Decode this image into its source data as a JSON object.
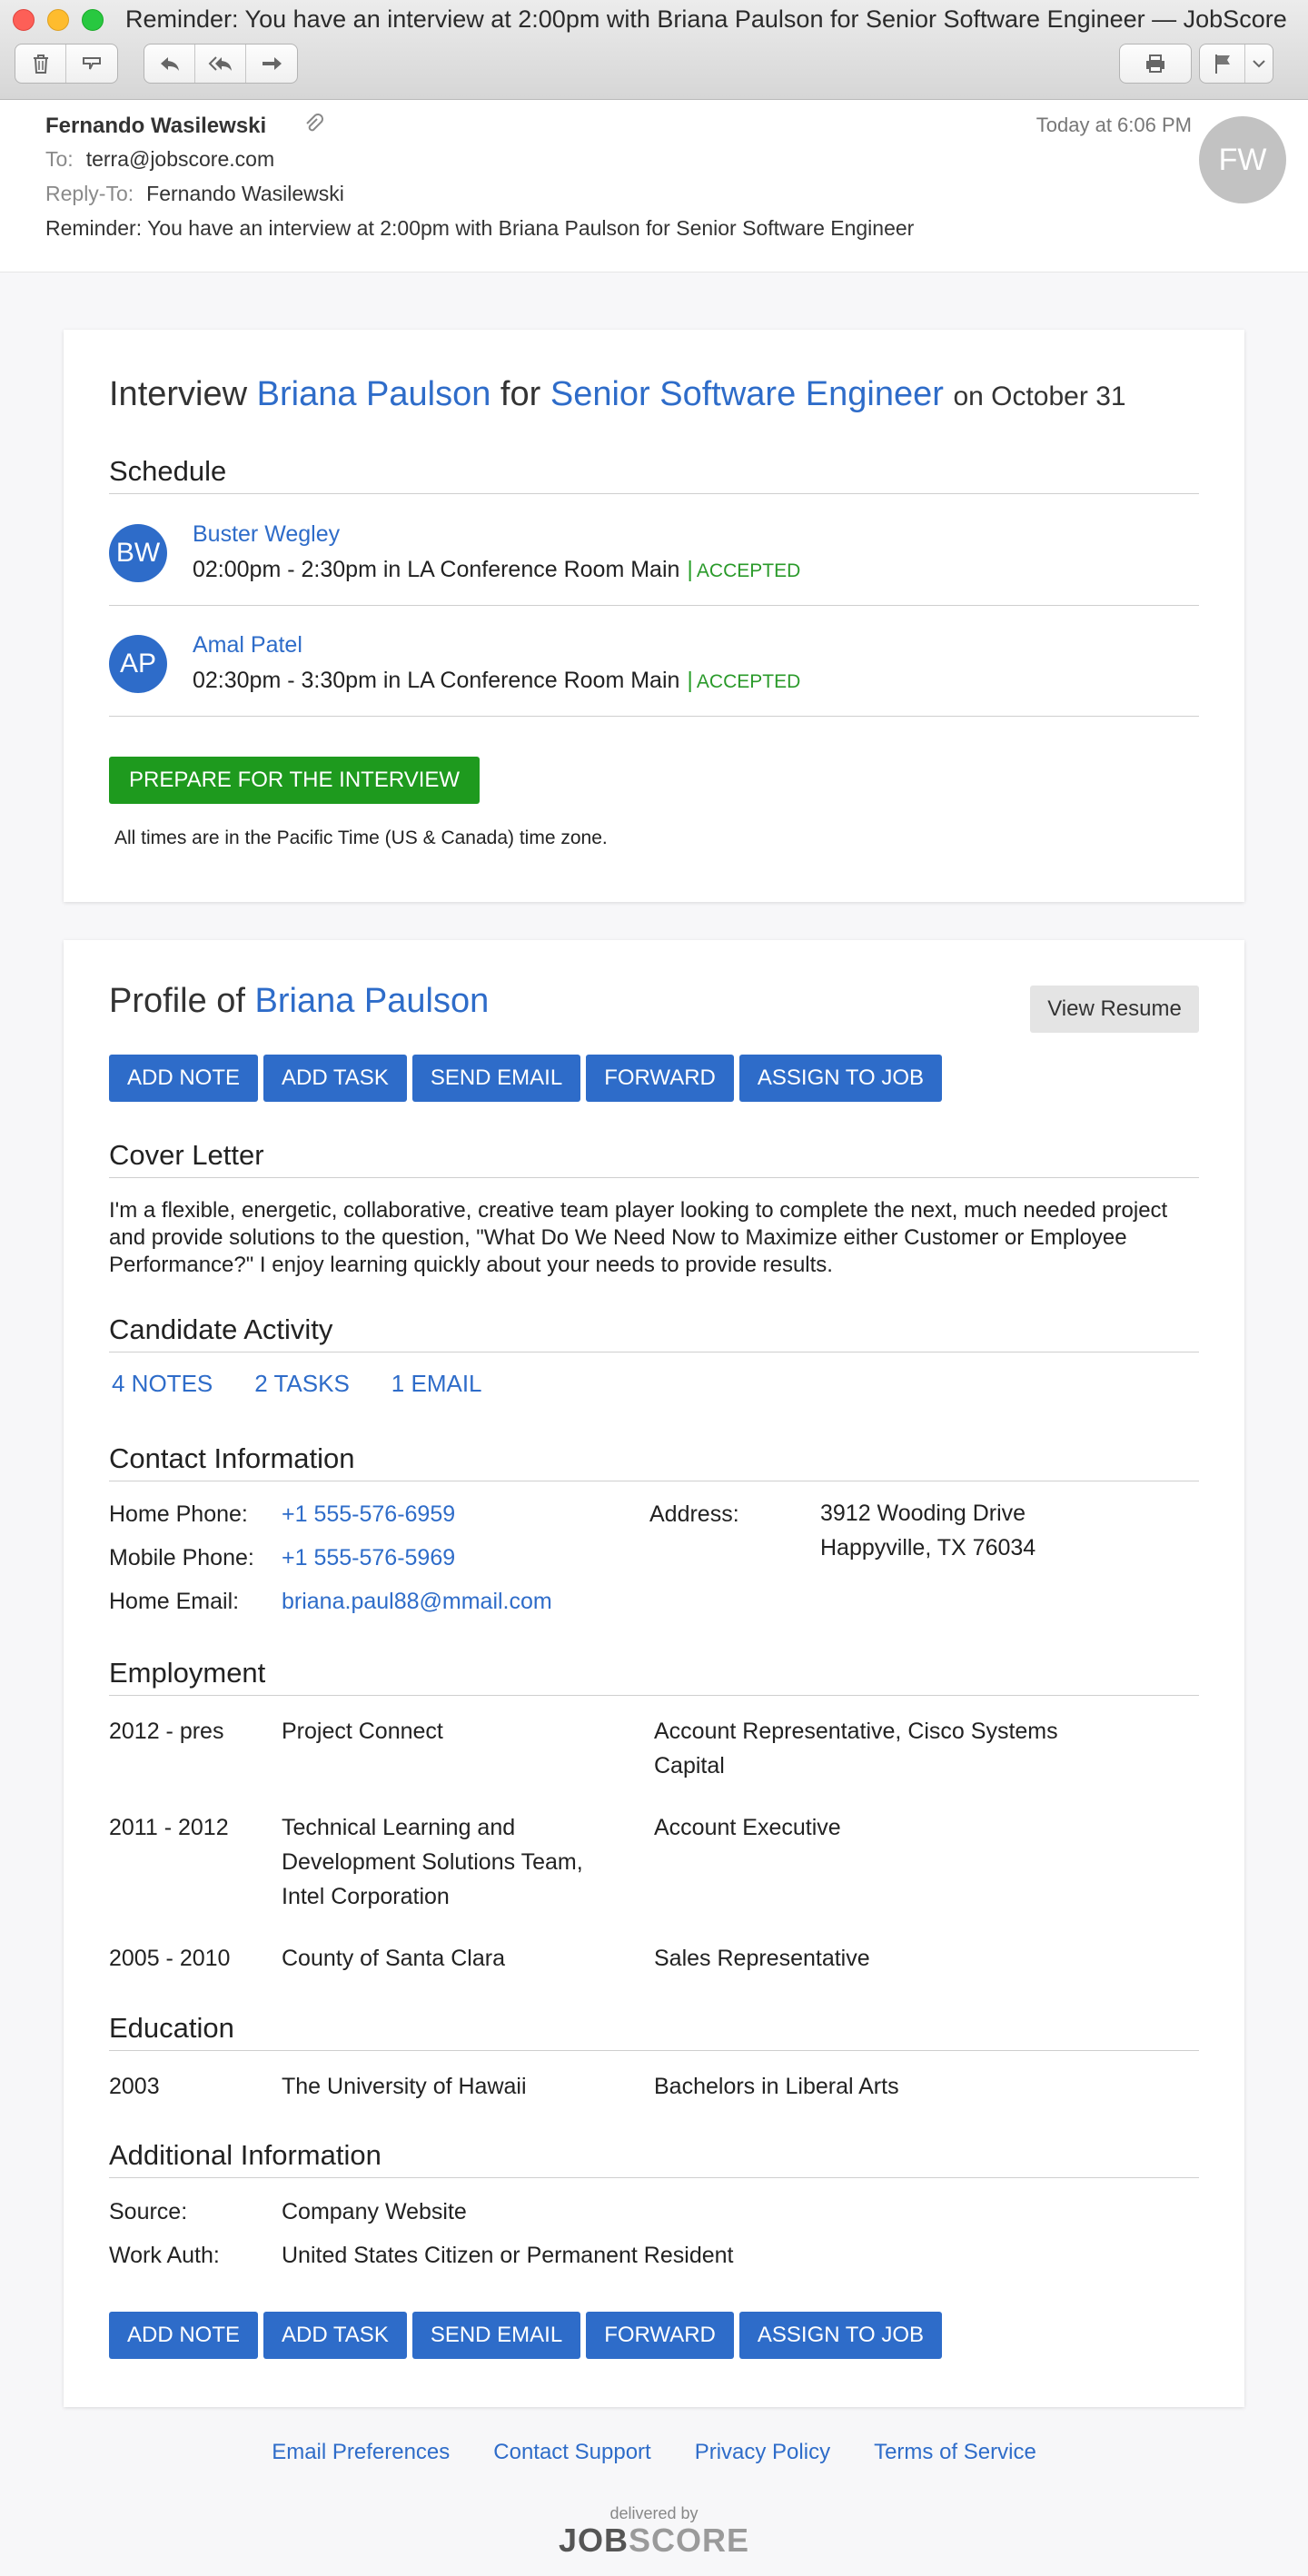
{
  "window": {
    "title": "Reminder: You have an interview at 2:00pm with Briana Paulson for Senior Software Engineer — JobScore",
    "toolbar_icons": [
      "trash-icon",
      "junk-icon",
      "reply-icon",
      "reply-all-icon",
      "forward-icon",
      "print-icon",
      "flag-icon",
      "chevron-down-icon"
    ]
  },
  "email": {
    "sender": "Fernando Wasilewski",
    "date": "Today at 6:06 PM",
    "avatar": "FW",
    "to_label": "To:",
    "to": "terra@jobscore.com",
    "reply_to_label": "Reply-To:",
    "reply_to": "Fernando Wasilewski",
    "subject": "Reminder: You have an interview at 2:00pm with Briana Paulson for Senior Software Engineer"
  },
  "interview": {
    "title_prefix": "Interview",
    "candidate": "Briana Paulson",
    "title_for": "for",
    "job": "Senior Software Engineer",
    "title_date": "on October 31",
    "schedule_title": "Schedule",
    "schedule": [
      {
        "initials": "BW",
        "name": "Buster Wegley",
        "time": "02:00pm - 2:30pm in LA Conference Room Main",
        "sep": "|",
        "status": "ACCEPTED"
      },
      {
        "initials": "AP",
        "name": "Amal Patel",
        "time": "02:30pm - 3:30pm in LA Conference Room Main",
        "sep": "|",
        "status": "ACCEPTED"
      }
    ],
    "prepare_button": "PREPARE FOR THE INTERVIEW",
    "timezone_note": "All times are in the Pacific Time (US & Canada) time zone."
  },
  "profile": {
    "title_prefix": "Profile of",
    "candidate": "Briana Paulson",
    "view_resume": "View Resume",
    "actions": [
      "ADD NOTE",
      "ADD TASK",
      "SEND EMAIL",
      "FORWARD",
      "ASSIGN TO JOB"
    ],
    "cover_title": "Cover Letter",
    "cover_text": "I'm a flexible, energetic, collaborative, creative team player looking to complete the next, much needed project and provide solutions to the question, \"What Do We Need Now to Maximize either Customer or Employee Performance?\" I enjoy learning quickly about your needs to provide results.",
    "activity_title": "Candidate Activity",
    "activity": [
      "4 NOTES",
      "2 TASKS",
      "1 EMAIL"
    ],
    "contact_title": "Contact Information",
    "contact": {
      "home_phone_label": "Home Phone:",
      "home_phone": "+1 555-576-6959",
      "mobile_phone_label": "Mobile Phone:",
      "mobile_phone": "+1 555-576-5969",
      "home_email_label": "Home Email:",
      "home_email": "briana.paul88@mmail.com",
      "address_label": "Address:",
      "address_line1": "3912 Wooding Drive",
      "address_line2": "Happyville, TX 76034"
    },
    "employment_title": "Employment",
    "employment": [
      {
        "years": "2012 - pres",
        "org": "Project Connect",
        "role": "Account Representative, Cisco Systems Capital"
      },
      {
        "years": "2011 - 2012",
        "org": "Technical Learning and Development Solutions Team, Intel Corporation",
        "role": "Account Executive"
      },
      {
        "years": "2005 - 2010",
        "org": "County of Santa Clara",
        "role": "Sales Representative"
      }
    ],
    "education_title": "Education",
    "education": [
      {
        "year": "2003",
        "school": "The University of Hawaii",
        "degree": "Bachelors in Liberal Arts"
      }
    ],
    "additional_title": "Additional Information",
    "additional": {
      "source_label": "Source:",
      "source": "Company Website",
      "work_auth_label": "Work Auth:",
      "work_auth": "United States Citizen or Permanent Resident"
    }
  },
  "footer": {
    "links": [
      "Email Preferences",
      "Contact Support",
      "Privacy Policy",
      "Terms of Service"
    ],
    "delivered_by": "delivered by",
    "logo_job": "JOB",
    "logo_score": "SCORE"
  }
}
